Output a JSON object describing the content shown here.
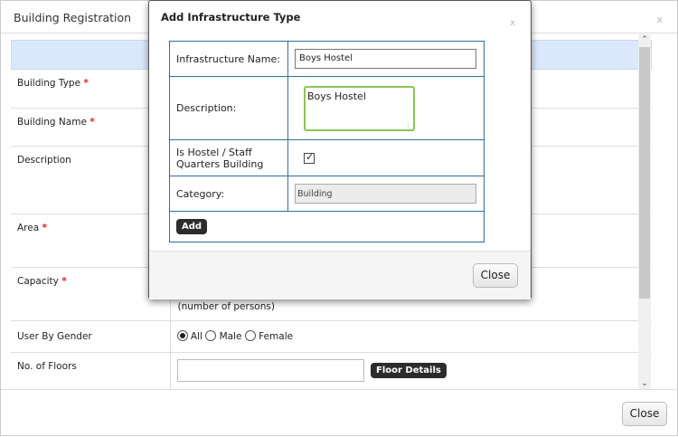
{
  "background_dialog": {
    "title": "Building Registration",
    "close_symbol": "x",
    "fields": [
      {
        "label": "Building Type",
        "required": true
      },
      {
        "label": "Building Name",
        "required": true
      },
      {
        "label": "Description",
        "required": false
      },
      {
        "label": "Area",
        "required": true
      },
      {
        "label": "Capacity",
        "required": true
      },
      {
        "label": "User By Gender",
        "required": false
      },
      {
        "label": "No. of Floors",
        "required": false
      }
    ],
    "required_marker": "*",
    "capacity_hint": "(number of persons)",
    "gender_options": [
      "All",
      "Male",
      "Female"
    ],
    "gender_selected": "All",
    "floors_value": "",
    "floor_details_button": "Floor Details",
    "scroll_up_glyph": "^",
    "scroll_down_glyph": "v",
    "close_button": "Close"
  },
  "modal": {
    "title": "Add Infrastructure Type",
    "close_symbol": "x",
    "name_label": "Infrastructure Name:",
    "name_value": "Boys Hostel",
    "description_label": "Description:",
    "description_value": "Boys Hostel",
    "hostel_label": "Is Hostel / Staff Quarters Building",
    "hostel_checked": true,
    "category_label": "Category:",
    "category_value": "Building",
    "add_button": "Add",
    "close_button": "Close"
  },
  "colors": {
    "accent_focus": "#8cc45a",
    "table_border": "#2e6f9e",
    "banner": "#dbe8fb",
    "required": "#e02020"
  }
}
